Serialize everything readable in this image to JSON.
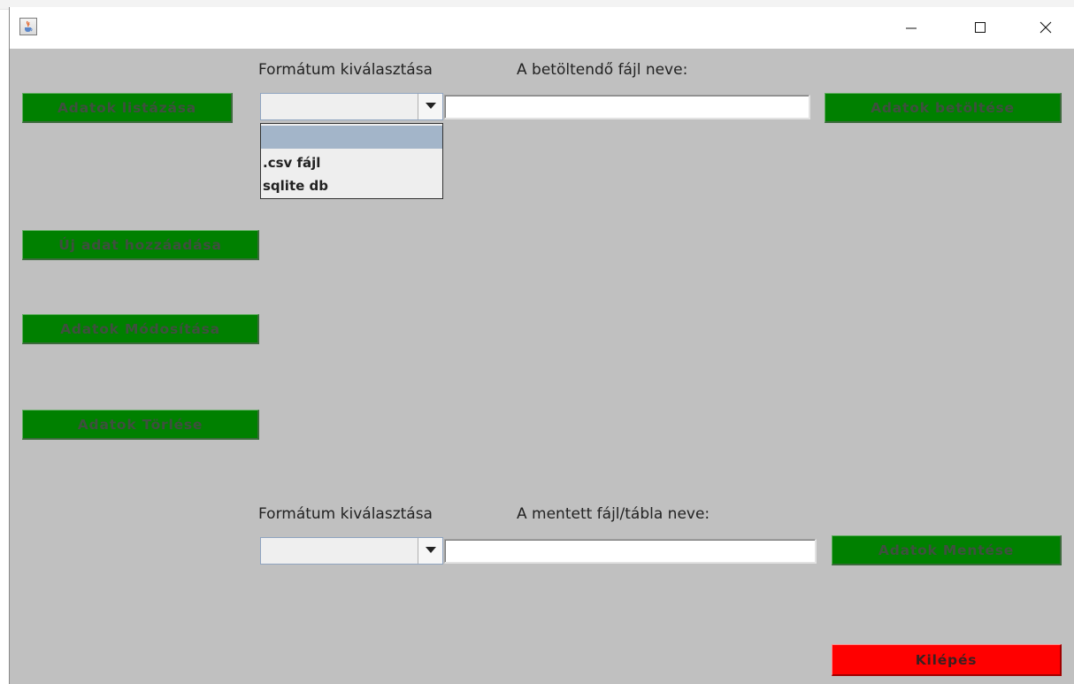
{
  "window": {
    "title": "",
    "controls": {
      "minimize": "minimize",
      "maximize": "maximize",
      "close": "close"
    }
  },
  "load_section": {
    "format_label": "Formátum kiválasztása",
    "file_label": "A betöltendő fájl neve:",
    "format_selected": "",
    "file_value": "",
    "load_button": "Adatok betöltése",
    "dropdown_options": [
      "",
      ".csv fájl",
      "sqlite db"
    ]
  },
  "side_buttons": {
    "list": "Adatok listázása",
    "add": "Új adat hozzáadása",
    "modify": "Adatok Módosítása",
    "delete": "Adatok Törlése"
  },
  "save_section": {
    "format_label": "Formátum kiválasztása",
    "file_label": "A mentett fájl/tábla neve:",
    "format_selected": "",
    "file_value": "",
    "save_button": "Adatok Mentése"
  },
  "exit_button": "Kilépés",
  "colors": {
    "green_button": "#008000",
    "red_button": "#ff0000",
    "panel_bg": "#c0c0c0",
    "dropdown_selection": "#a3b5c9"
  }
}
